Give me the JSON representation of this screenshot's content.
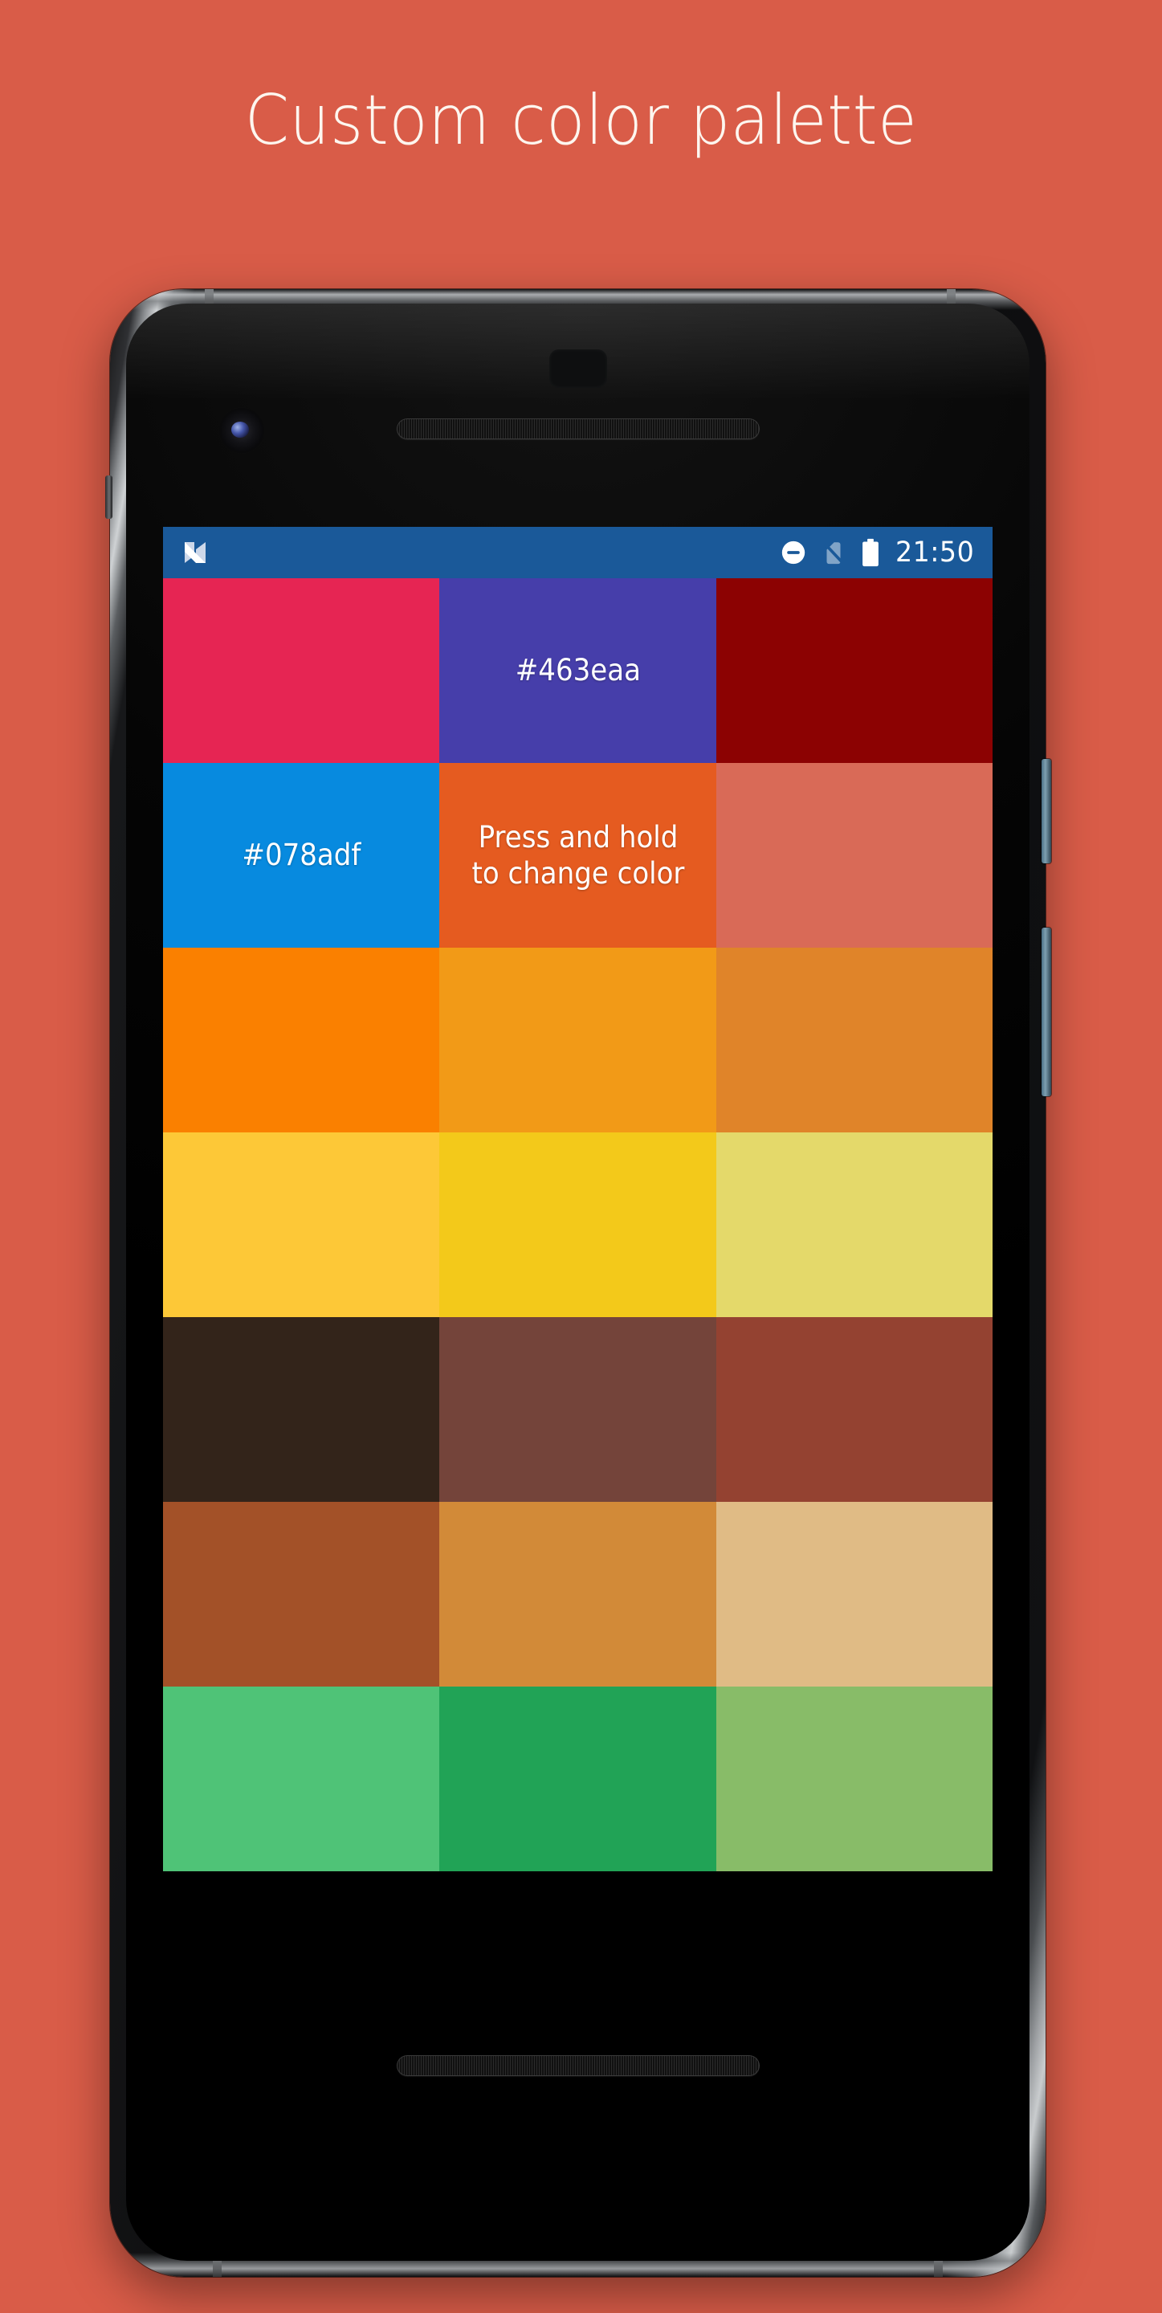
{
  "page": {
    "title": "Custom color palette",
    "background_color": "#d95c48",
    "title_color": "#fdf6ef"
  },
  "device": {
    "name": "google-pixel-2",
    "body_color": "#0b0b0c",
    "frame_accent": "#c9ccce",
    "components": {
      "front_camera": "front-camera-icon",
      "earpiece_speaker": "earpiece-speaker-grille",
      "proximity_sensor": "proximity-sensor",
      "bottom_speaker": "bottom-speaker-grille",
      "power_button": "power-button",
      "volume_button": "volume-button"
    }
  },
  "status_bar": {
    "background_color": "#1a5999",
    "text_color": "#ffffff",
    "app_icon": "android-nougat-icon",
    "icons": [
      {
        "name": "do-not-disturb-icon",
        "label": "Do not disturb"
      },
      {
        "name": "no-sim-icon",
        "label": "No SIM card"
      },
      {
        "name": "battery-full-icon",
        "label": "Battery full"
      }
    ],
    "time": "21:50"
  },
  "palette": {
    "rows": 7,
    "columns": 3,
    "swatches": [
      {
        "color": "#e62553",
        "label": "",
        "name": "swatch-crimson"
      },
      {
        "color": "#463eaa",
        "label": "#463eaa",
        "name": "swatch-indigo"
      },
      {
        "color": "#8c0202",
        "label": "",
        "name": "swatch-dark-red"
      },
      {
        "color": "#078adf",
        "label": "#078adf",
        "name": "swatch-blue"
      },
      {
        "color": "#e55b20",
        "label": "Press and hold\nto change color",
        "name": "swatch-orange-hint"
      },
      {
        "color": "#d96a57",
        "label": "",
        "name": "swatch-salmon"
      },
      {
        "color": "#fa8000",
        "label": "",
        "name": "swatch-bright-orange"
      },
      {
        "color": "#f29a17",
        "label": "",
        "name": "swatch-amber"
      },
      {
        "color": "#e08429",
        "label": "",
        "name": "swatch-burnt-orange"
      },
      {
        "color": "#fdc837",
        "label": "",
        "name": "swatch-sunflower"
      },
      {
        "color": "#f3c91a",
        "label": "",
        "name": "swatch-golden-yellow"
      },
      {
        "color": "#e4d96a",
        "label": "",
        "name": "swatch-pale-yellow"
      },
      {
        "color": "#33241a",
        "label": "",
        "name": "swatch-dark-brown"
      },
      {
        "color": "#74443a",
        "label": "",
        "name": "swatch-cocoa"
      },
      {
        "color": "#944231",
        "label": "",
        "name": "swatch-brick"
      },
      {
        "color": "#a35128",
        "label": "",
        "name": "swatch-sienna"
      },
      {
        "color": "#d28a38",
        "label": "",
        "name": "swatch-caramel"
      },
      {
        "color": "#e0bb85",
        "label": "",
        "name": "swatch-tan"
      },
      {
        "color": "#4fc377",
        "label": "",
        "name": "swatch-mint-green"
      },
      {
        "color": "#21a356",
        "label": "",
        "name": "swatch-green"
      },
      {
        "color": "#88bc68",
        "label": "",
        "name": "swatch-olive-green"
      }
    ]
  }
}
